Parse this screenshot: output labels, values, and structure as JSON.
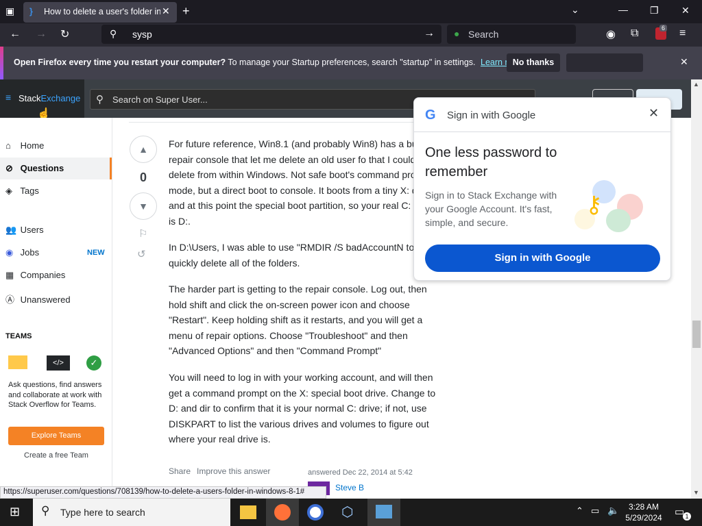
{
  "browser": {
    "tab_title": "How to delete a user's folder in W",
    "url_value": "sysp",
    "search_placeholder": "Search",
    "extension_badge": "6"
  },
  "notification": {
    "bold": "Open Firefox every time you restart your computer?",
    "text": "To manage your Startup preferences, search \"startup\" in settings.",
    "learn_more": "Learn more",
    "no_thanks": "No thanks"
  },
  "site": {
    "logo_stack": "Stack",
    "logo_exchange": "Exchange",
    "search_placeholder": "Search on Super User..."
  },
  "sidebar": {
    "home": "Home",
    "questions": "Questions",
    "tags": "Tags",
    "users": "Users",
    "jobs": "Jobs",
    "jobs_badge": "NEW",
    "companies": "Companies",
    "unanswered": "Unanswered",
    "teams_heading": "TEAMS",
    "teams_text": "Ask questions, find answers and collaborate at work with Stack Overflow for Teams.",
    "explore_button": "Explore Teams",
    "create_team": "Create a free Team"
  },
  "answer": {
    "score": "0",
    "paragraphs": [
      "For future reference, Win8.1 (and probably Win8) has a built-in repair console that let me delete an old user fo that I could not delete from within Windows. Not safe boot's command prompt mode, but a direct boot to console. It boots from a tiny X: drive, and at this point the special boot partition, so your real C: drive is D:.",
      "In D:\\Users, I was able to use \"RMDIR /S badAccountN to quickly delete all of the folders.",
      "The harder part is getting to the repair console. Log out, then hold shift and click the on-screen power icon and choose \"Restart\". Keep holding shift as it restarts, and you will get a menu of repair options. Choose \"Troubleshoot\" and then \"Advanced Options\" and then \"Command Prompt\"",
      "You will need to log in with your working account, and will then get a command prompt on the X: special boot drive. Change to D: and dir to confirm that it is your normal C: drive; if not, use DISKPART to list the various drives and volumes to figure out where your real drive is."
    ],
    "share": "Share",
    "improve": "Improve this answer",
    "answered": "answered Dec 22, 2014 at 5:42",
    "author": "Steve B"
  },
  "google_popup": {
    "header": "Sign in with Google",
    "title": "One less password to remember",
    "body": "Sign in to Stack Exchange with your Google Account. It's fast, simple, and secure.",
    "button": "Sign in with Google"
  },
  "status_url": "https://superuser.com/questions/708139/how-to-delete-a-users-folder-in-windows-8-1#",
  "taskbar": {
    "search_placeholder": "Type here to search",
    "time": "3:28 AM",
    "date": "5/29/2024",
    "notif_count": "1"
  }
}
